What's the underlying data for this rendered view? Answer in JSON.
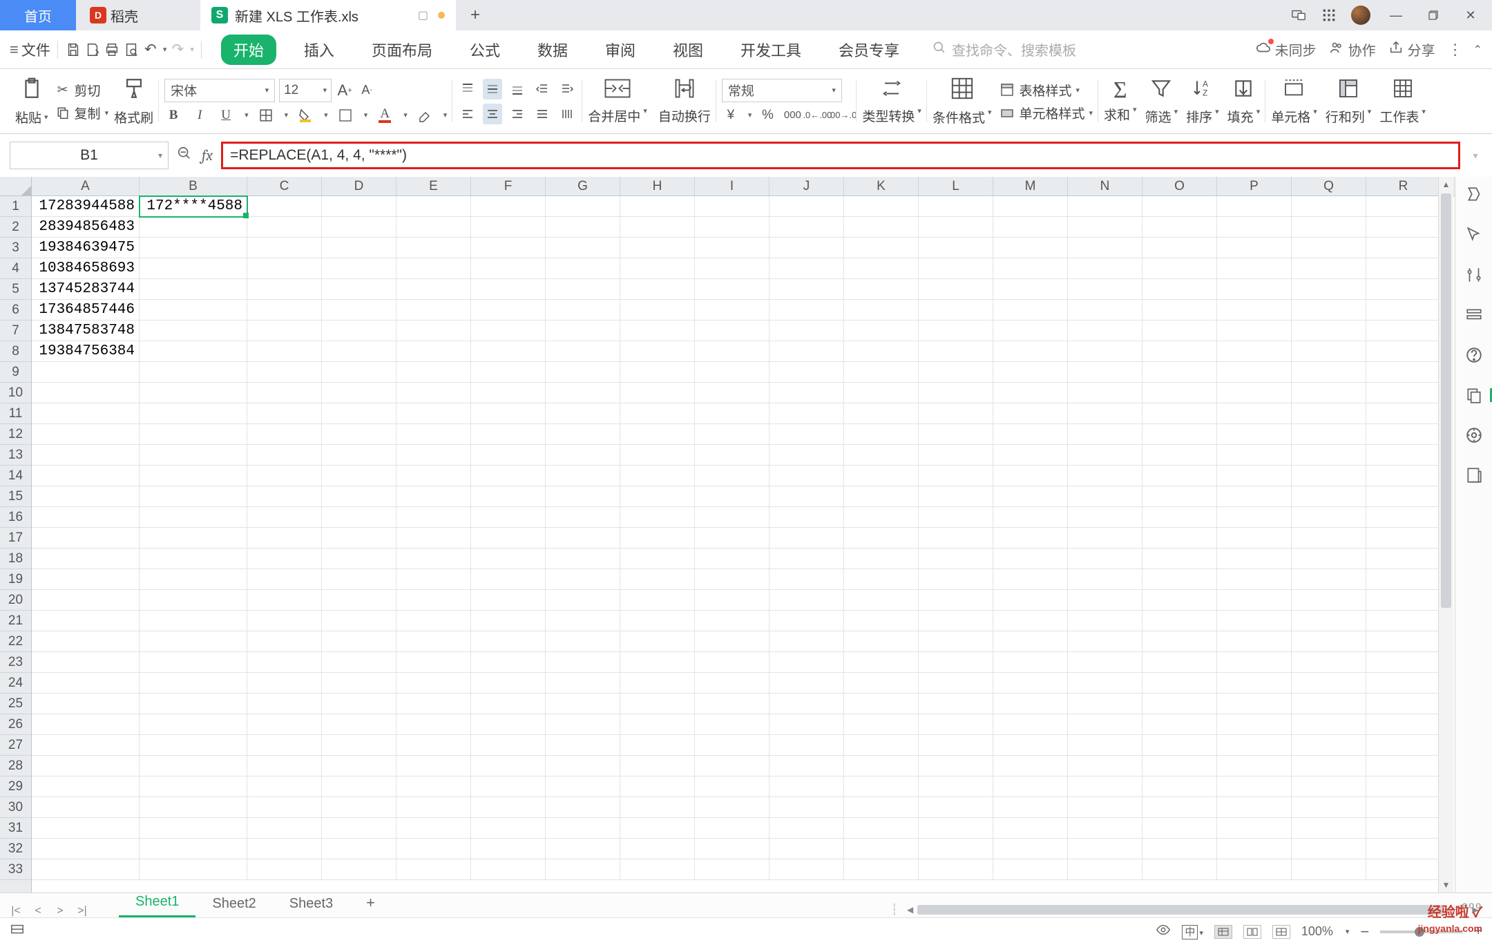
{
  "titlebar": {
    "home": "首页",
    "docer": "稻壳",
    "filename": "新建 XLS 工作表.xls",
    "device_icon": "device-icon",
    "appgrid_icon": "app-grid-icon"
  },
  "menubar": {
    "file": "文件",
    "tabs": [
      "开始",
      "插入",
      "页面布局",
      "公式",
      "数据",
      "审阅",
      "视图",
      "开发工具",
      "会员专享"
    ],
    "active_tab_index": 0,
    "search_placeholder": "查找命令、搜索模板",
    "unsynced": "未同步",
    "collab": "协作",
    "share": "分享"
  },
  "ribbon": {
    "paste": "粘贴",
    "cut": "剪切",
    "copy": "复制",
    "format_painter": "格式刷",
    "font_name": "宋体",
    "font_size": "12",
    "merge_center": "合并居中",
    "auto_wrap": "自动换行",
    "number_format": "常规",
    "type_convert": "类型转换",
    "cond_format": "条件格式",
    "table_style": "表格样式",
    "cell_style": "单元格样式",
    "sum": "求和",
    "filter": "筛选",
    "sort": "排序",
    "fill": "填充",
    "cell": "单元格",
    "rowcol": "行和列",
    "worksheet": "工作表"
  },
  "formula_bar": {
    "name_box": "B1",
    "formula": "=REPLACE(A1, 4, 4, \"****\")"
  },
  "grid": {
    "columns": [
      "A",
      "B",
      "C",
      "D",
      "E",
      "F",
      "G",
      "H",
      "I",
      "J",
      "K",
      "L",
      "M",
      "N",
      "O",
      "P",
      "Q",
      "R"
    ],
    "row_count": 33,
    "active_cell": "B1",
    "data": {
      "A": [
        "17283944588",
        "28394856483",
        "19384639475",
        "10384658693",
        "13745283744",
        "17364857446",
        "13847583748",
        "19384756384"
      ],
      "B": [
        "172****4588"
      ]
    }
  },
  "sheets": {
    "tabs": [
      "Sheet1",
      "Sheet2",
      "Sheet3"
    ],
    "active_index": 0
  },
  "statusbar": {
    "zoom": "100%"
  },
  "watermark": {
    "main": "经验啦",
    "sub": "jingyanla.com"
  }
}
